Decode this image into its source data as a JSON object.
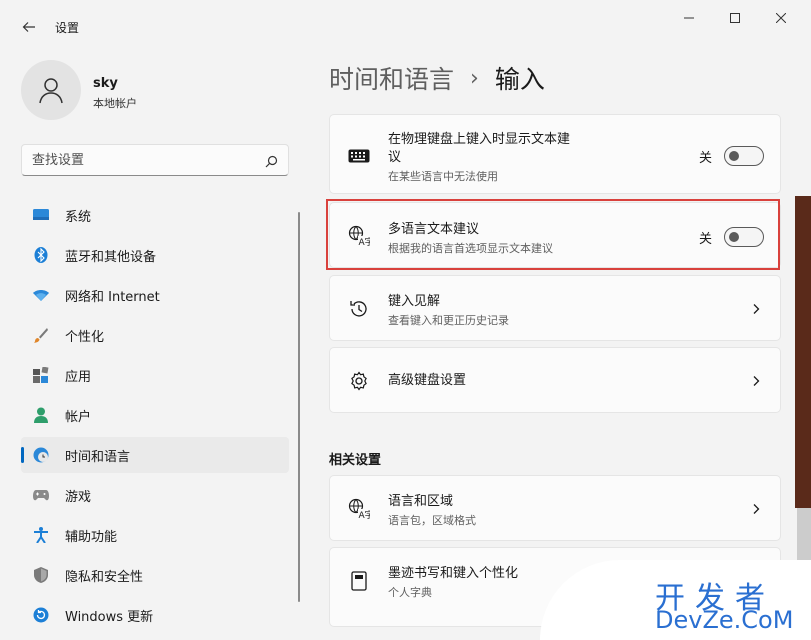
{
  "window": {
    "title": "设置"
  },
  "user": {
    "name": "sky",
    "account_type": "本地帐户"
  },
  "search": {
    "placeholder": "查找设置"
  },
  "nav": {
    "items": [
      {
        "label": "系统",
        "icon": "monitor-icon"
      },
      {
        "label": "蓝牙和其他设备",
        "icon": "bluetooth-icon"
      },
      {
        "label": "网络和 Internet",
        "icon": "wifi-icon"
      },
      {
        "label": "个性化",
        "icon": "brush-icon"
      },
      {
        "label": "应用",
        "icon": "apps-icon"
      },
      {
        "label": "帐户",
        "icon": "person-icon"
      },
      {
        "label": "时间和语言",
        "icon": "globe-clock-icon",
        "active": true
      },
      {
        "label": "游戏",
        "icon": "gamepad-icon"
      },
      {
        "label": "辅助功能",
        "icon": "accessibility-icon"
      },
      {
        "label": "隐私和安全性",
        "icon": "shield-icon"
      },
      {
        "label": "Windows 更新",
        "icon": "update-icon"
      }
    ]
  },
  "breadcrumb": {
    "parent": "时间和语言",
    "separator": "›",
    "current": "输入"
  },
  "cards": {
    "physical_keyboard": {
      "title_line1": "在物理键盘上键入时显示文本建",
      "title_line2": "议",
      "subtitle": "在某些语言中无法使用",
      "toggle_state": "关"
    },
    "multilingual": {
      "title": "多语言文本建议",
      "subtitle": "根据我的语言首选项显示文本建议",
      "toggle_state": "关"
    },
    "typing_insights": {
      "title": "键入见解",
      "subtitle": "查看键入和更正历史记录"
    },
    "advanced_keyboard": {
      "title": "高级键盘设置"
    }
  },
  "related": {
    "heading": "相关设置",
    "language_region": {
      "title": "语言和区域",
      "subtitle": "语言包，区域格式"
    },
    "pen_ink": {
      "title": "墨迹书写和键入个性化",
      "subtitle": "个人字典"
    }
  },
  "watermark": {
    "line1": "开发者",
    "line2": "DevZe.CoM"
  },
  "colors": {
    "accent": "#0067c0",
    "highlight": "#d9413c",
    "watermark": "#2a6fd1"
  }
}
